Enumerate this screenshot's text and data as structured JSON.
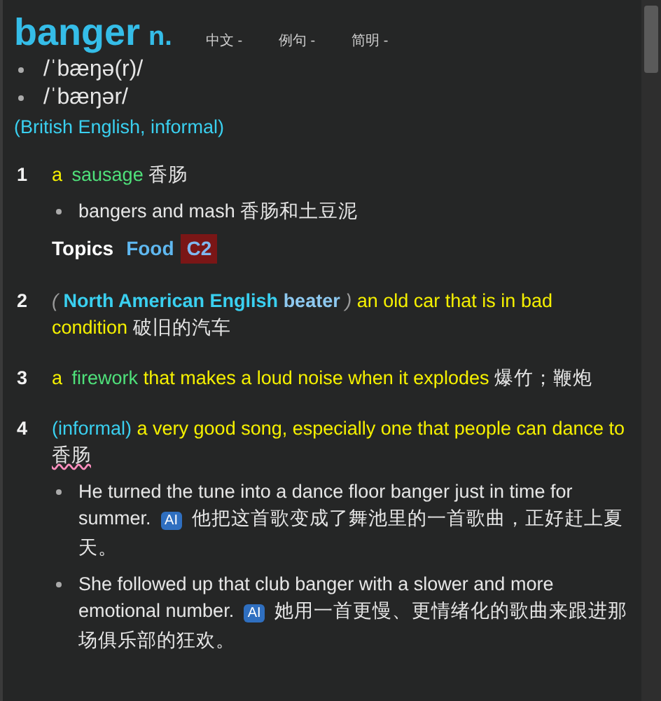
{
  "headword": "banger",
  "pos": "n.",
  "tabs": [
    {
      "label": "中文 -"
    },
    {
      "label": "例句 -"
    },
    {
      "label": "简明 -"
    }
  ],
  "pronunciations": [
    "/ˈbæŋə(r)/",
    "/ˈbæŋər/"
  ],
  "usage_label": "(British English, informal)",
  "senses": [
    {
      "number": "1",
      "parts": [
        {
          "kind": "grammar",
          "text": "a"
        },
        {
          "kind": "guideword",
          "text": "sausage"
        },
        {
          "kind": "zh",
          "text": "香肠"
        }
      ],
      "examples": [
        {
          "text": "bangers and mash",
          "zh": "香肠和土豆泥"
        }
      ],
      "topics": {
        "label": "Topics",
        "items": [
          "Food"
        ],
        "level": "C2"
      }
    },
    {
      "number": "2",
      "parts": [
        {
          "kind": "paren",
          "text": "("
        },
        {
          "kind": "label",
          "text": "North American English"
        },
        {
          "kind": "variant",
          "text": "beater"
        },
        {
          "kind": "paren",
          "text": ")"
        },
        {
          "kind": "definition",
          "text": "an old car that is in bad condition"
        },
        {
          "kind": "zh",
          "text": "破旧的汽车"
        }
      ]
    },
    {
      "number": "3",
      "parts": [
        {
          "kind": "grammar",
          "text": "a"
        },
        {
          "kind": "guideword",
          "text": "firework"
        },
        {
          "kind": "definition",
          "text": "that makes a loud noise when it explodes"
        },
        {
          "kind": "zh",
          "text": "爆竹；鞭炮"
        }
      ]
    },
    {
      "number": "4",
      "parts": [
        {
          "kind": "usage",
          "text": "(informal)"
        },
        {
          "kind": "definition",
          "text": "a very good song, especially one that people can dance to"
        },
        {
          "kind": "zh-marked",
          "text": "香肠"
        }
      ],
      "examples": [
        {
          "text": "He turned the tune into a dance floor banger just in time for summer.",
          "badge": "AI",
          "zh": "他把这首歌变成了舞池里的一首歌曲，正好赶上夏天。"
        },
        {
          "text": "She followed up that club banger with a slower and more emotional number.",
          "badge": "AI",
          "zh": "她用一首更慢、更情绪化的歌曲来跟进那场俱乐部的狂欢。"
        }
      ]
    }
  ]
}
